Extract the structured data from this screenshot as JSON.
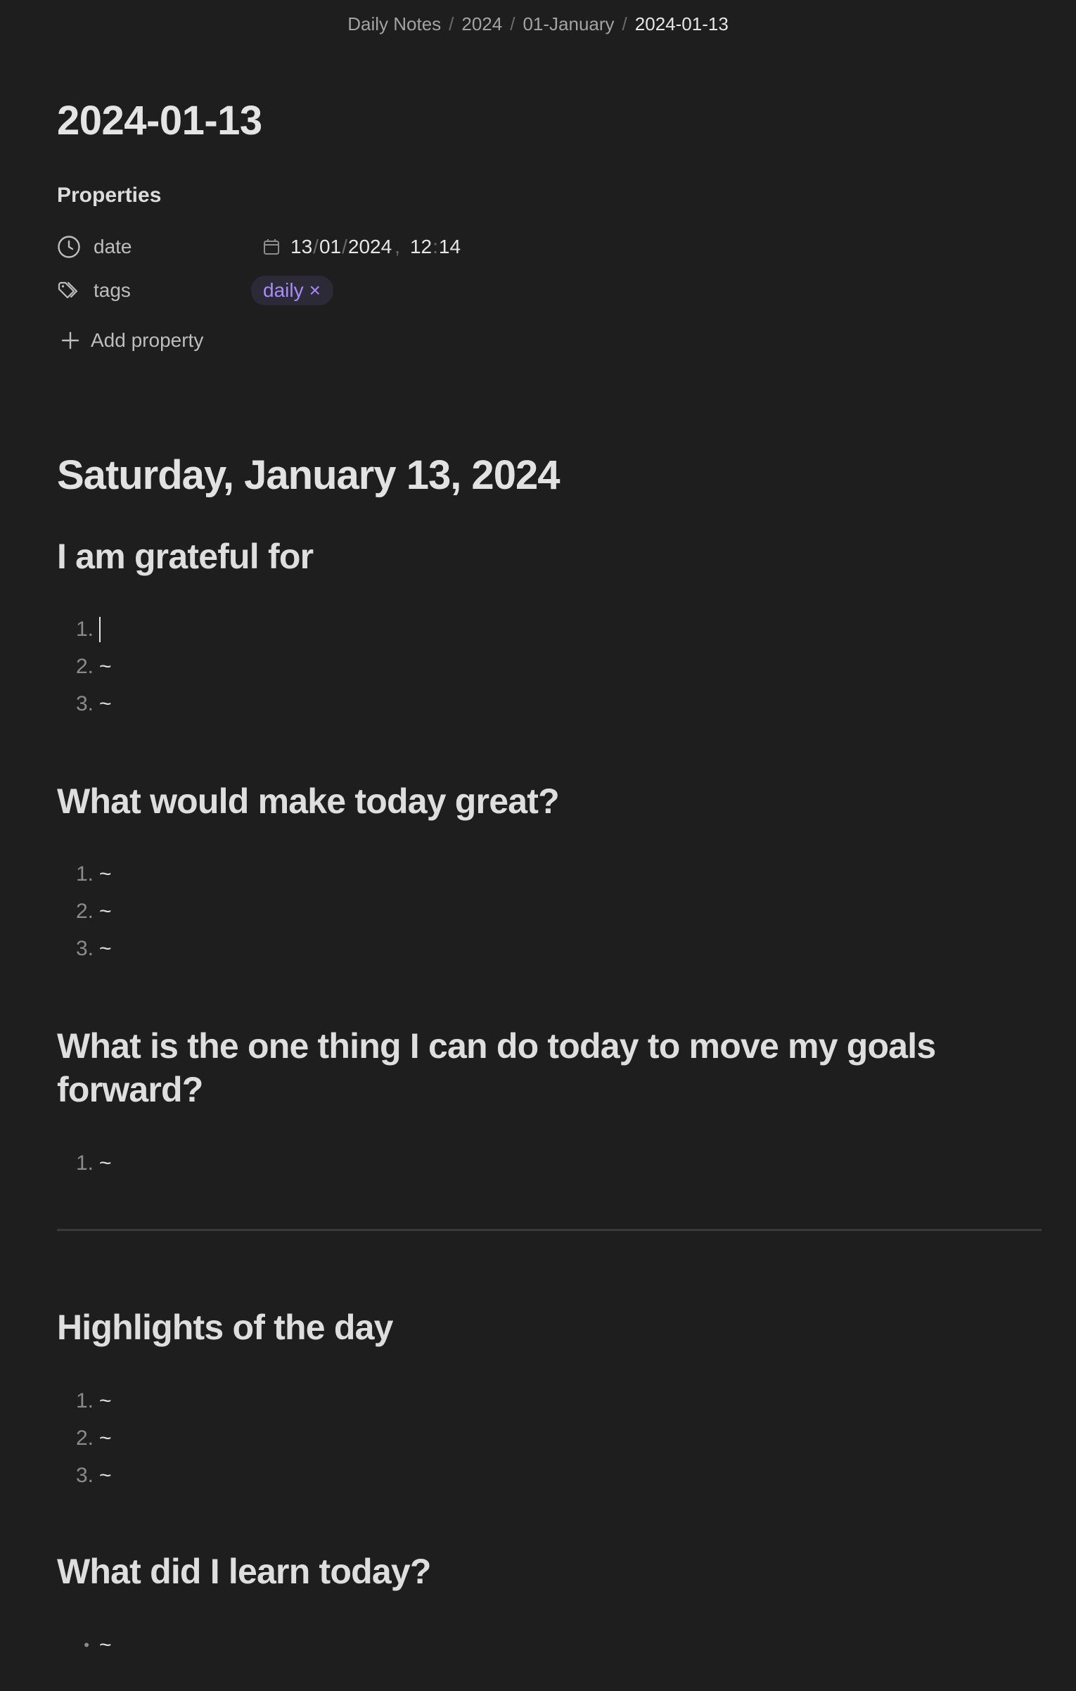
{
  "breadcrumb": {
    "items": [
      "Daily Notes",
      "2024",
      "01-January",
      "2024-01-13"
    ],
    "separator": "/"
  },
  "page": {
    "title": "2024-01-13"
  },
  "properties": {
    "heading": "Properties",
    "date": {
      "key": "date",
      "day": "13",
      "month": "01",
      "year": "2024",
      "date_separator": "/",
      "comma": ",",
      "hour": "12",
      "minute": "14",
      "time_separator": ":"
    },
    "tags": {
      "key": "tags",
      "values": [
        "daily"
      ],
      "remove_glyph": "×"
    },
    "add_label": "Add property"
  },
  "note": {
    "date_heading": "Saturday, January 13, 2024",
    "sections": [
      {
        "heading": "I am grateful for",
        "items": [
          {
            "marker": "1.",
            "text": ""
          },
          {
            "marker": "2.",
            "text": "~"
          },
          {
            "marker": "3.",
            "text": "~"
          }
        ]
      },
      {
        "heading": "What would make today great?",
        "items": [
          {
            "marker": "1.",
            "text": "~"
          },
          {
            "marker": "2.",
            "text": "~"
          },
          {
            "marker": "3.",
            "text": "~"
          }
        ]
      },
      {
        "heading": "What is the one thing I can do today to move my goals forward?",
        "items": [
          {
            "marker": "1.",
            "text": "~"
          }
        ]
      },
      {
        "heading": "Highlights of the day",
        "items": [
          {
            "marker": "1.",
            "text": "~"
          },
          {
            "marker": "2.",
            "text": "~"
          },
          {
            "marker": "3.",
            "text": "~"
          }
        ]
      },
      {
        "heading": "What did I learn today?",
        "items": [
          {
            "marker": "•",
            "text": "~"
          }
        ]
      }
    ]
  },
  "colors": {
    "background": "#1e1e1e",
    "tag_text": "#a88bfa",
    "tag_background": "#2c2a36",
    "divider": "#3a3a3a"
  }
}
